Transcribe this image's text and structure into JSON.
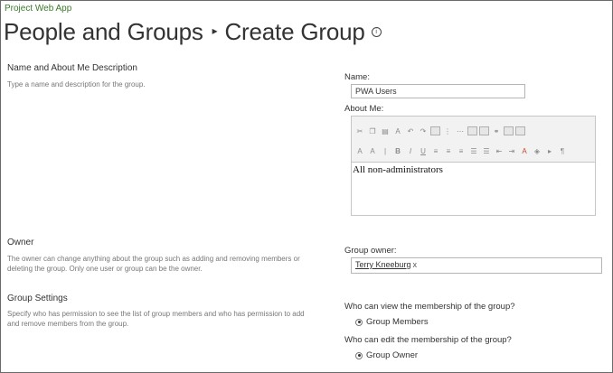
{
  "app": {
    "suite_title": "Project Web App"
  },
  "header": {
    "breadcrumb_parent": "People and Groups",
    "separator": "▸",
    "page_title": "Create Group",
    "info_icon": "i"
  },
  "sections": {
    "name": {
      "heading": "Name and About Me Description",
      "description": "Type a name and description for the group.",
      "name_label": "Name:",
      "name_value": "PWA Users",
      "about_label": "About Me:",
      "about_value": "All non-administrators"
    },
    "owner": {
      "heading": "Owner",
      "description": "The owner can change anything about the group such as adding and removing members or deleting the group. Only one user or group can be the owner.",
      "field_label": "Group owner:",
      "owner_name": "Terry Kneeburg",
      "remove": "x"
    },
    "settings": {
      "heading": "Group Settings",
      "description": "Specify who has permission to see the list of group members and who has permission to add and remove members from the group.",
      "view_question": "Who can view the membership of the group?",
      "view_selected": "Group Members",
      "edit_question": "Who can edit the membership of the group?",
      "edit_selected": "Group Owner"
    }
  }
}
